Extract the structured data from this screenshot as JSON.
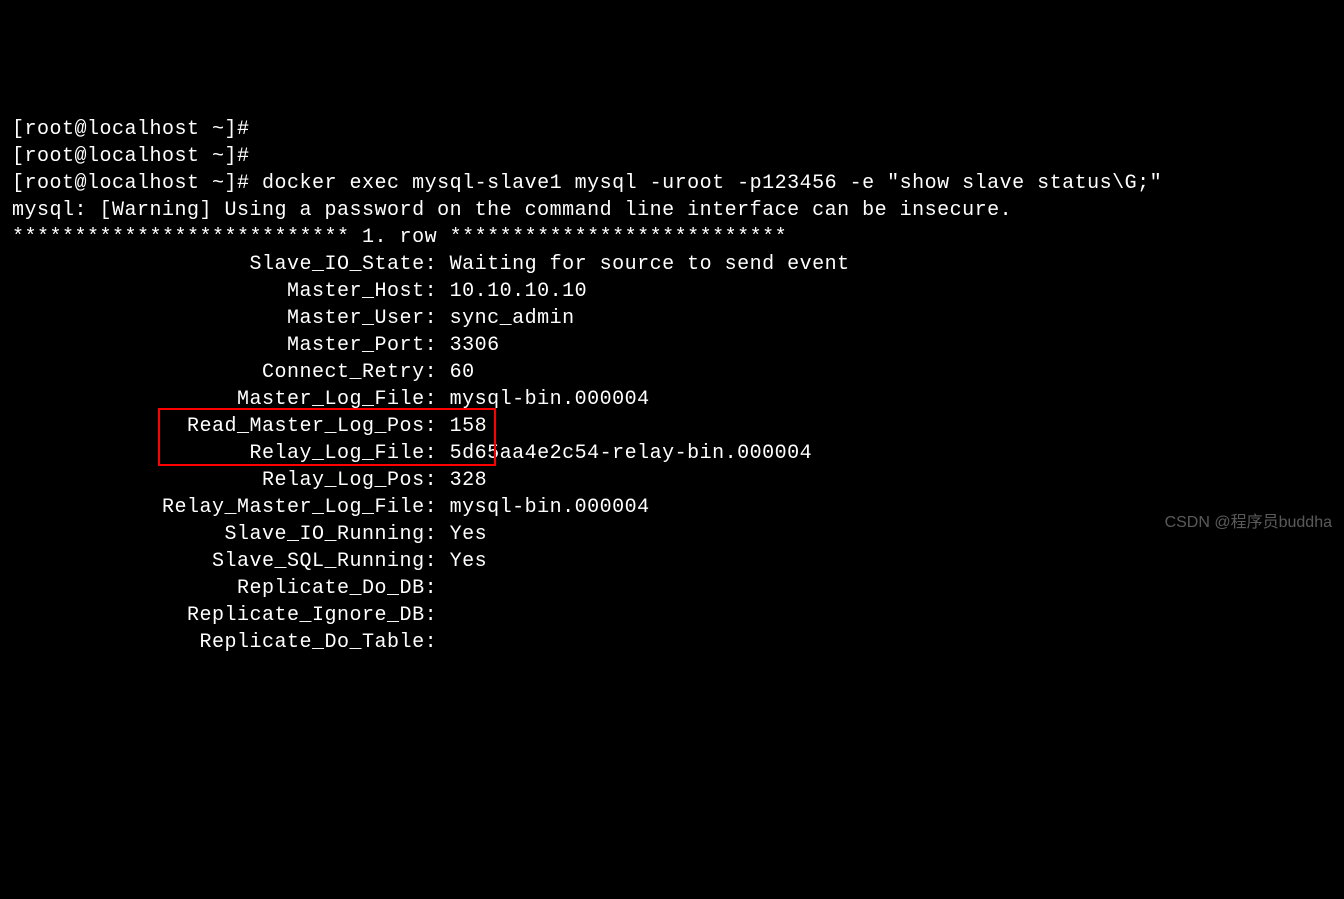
{
  "prompt1": "[root@localhost ~]#",
  "prompt2": "[root@localhost ~]#",
  "prompt3": "[root@localhost ~]# docker exec mysql-slave1 mysql -uroot -p123456 -e \"show slave status\\G;\"",
  "warning": "mysql: [Warning] Using a password on the command line interface can be insecure.",
  "rowheader": "*************************** 1. row ***************************",
  "fields": [
    {
      "label": "Slave_IO_State",
      "value": "Waiting for source to send event"
    },
    {
      "label": "Master_Host",
      "value": "10.10.10.10"
    },
    {
      "label": "Master_User",
      "value": "sync_admin"
    },
    {
      "label": "Master_Port",
      "value": "3306"
    },
    {
      "label": "Connect_Retry",
      "value": "60"
    },
    {
      "label": "Master_Log_File",
      "value": "mysql-bin.000004"
    },
    {
      "label": "Read_Master_Log_Pos",
      "value": "158"
    },
    {
      "label": "Relay_Log_File",
      "value": "5d65aa4e2c54-relay-bin.000004"
    },
    {
      "label": "Relay_Log_Pos",
      "value": "328"
    },
    {
      "label": "Relay_Master_Log_File",
      "value": "mysql-bin.000004"
    },
    {
      "label": "Slave_IO_Running",
      "value": "Yes"
    },
    {
      "label": "Slave_SQL_Running",
      "value": "Yes"
    },
    {
      "label": "Replicate_Do_DB",
      "value": ""
    },
    {
      "label": "Replicate_Ignore_DB",
      "value": ""
    },
    {
      "label": "Replicate_Do_Table",
      "value": ""
    }
  ],
  "labelWidth": 33,
  "watermark": "CSDN @程序员buddha"
}
